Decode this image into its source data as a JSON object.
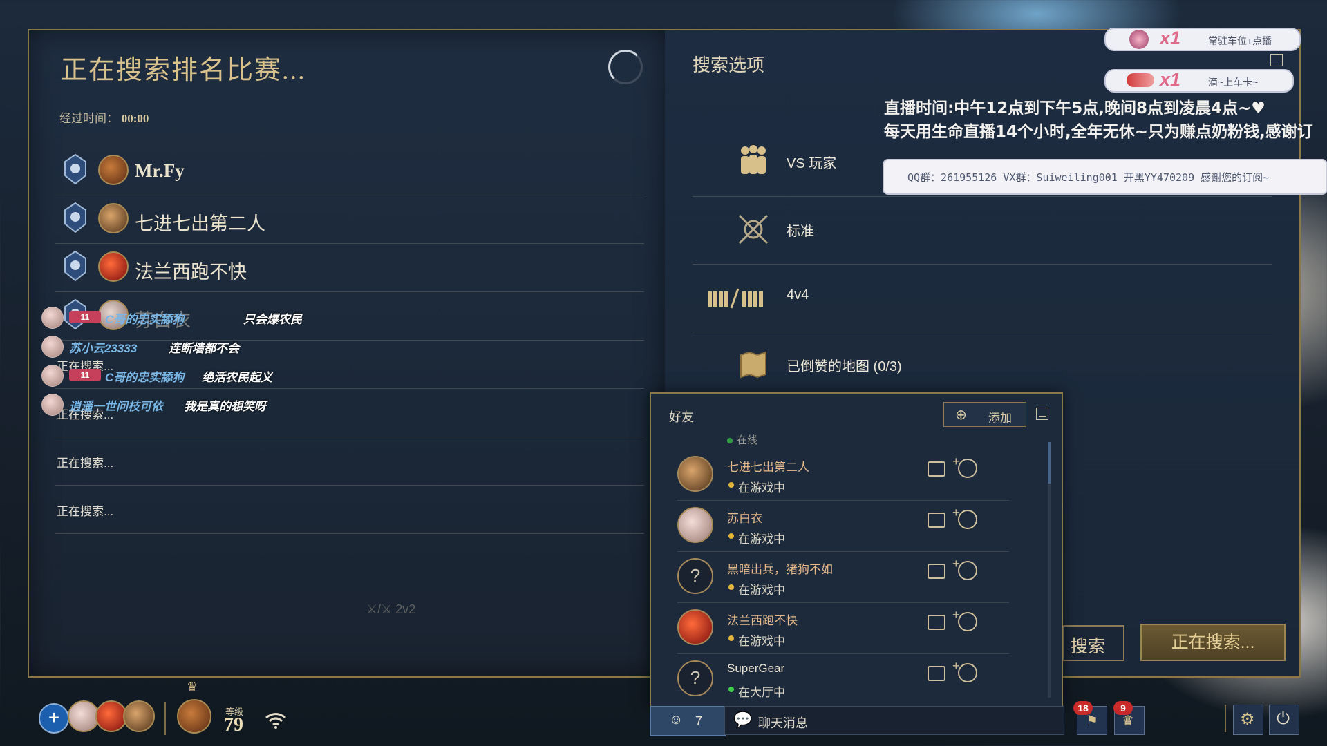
{
  "left_panel": {
    "title": "正在搜索排名比赛...",
    "elapsed_label": "经过时间：",
    "elapsed_value": "00:00",
    "players": [
      {
        "name": "Mr.Fy"
      },
      {
        "name": "七进七出第二人"
      },
      {
        "name": "法兰西跑不快"
      },
      {
        "name": "苏白衣"
      }
    ],
    "searching_slots": [
      "正在搜索...",
      "正在搜索...",
      "正在搜索...",
      "正在搜索..."
    ],
    "footer_mode": "2v2"
  },
  "chat_overlay": [
    {
      "badge": "11",
      "user": "C哥的忠实舔狗",
      "message": "只会爆农民"
    },
    {
      "badge": "",
      "user": "苏小云23333",
      "message": "连断墙都不会"
    },
    {
      "badge": "11",
      "user": "C哥的忠实舔狗",
      "message": "绝活农民起义"
    },
    {
      "badge": "",
      "user": "逍遥一世问枝可依",
      "message": "我是真的想笑呀"
    }
  ],
  "right_panel": {
    "title": "搜索选项",
    "options": [
      {
        "icon": "players-icon",
        "label": "VS 玩家"
      },
      {
        "icon": "crossed-swords-icon",
        "label": "标准"
      },
      {
        "icon": "team-size-icon",
        "label": "4v4"
      },
      {
        "icon": "map-icon",
        "label": "已倒赞的地图 (0/3)"
      }
    ],
    "search_button": "搜索",
    "searching_button": "正在搜索..."
  },
  "stream_overlay": {
    "line1": "直播时间:中午12点到下午5点,晚间8点到凌晨4点~♥",
    "line2": "每天用生命直播14个小时,全年无休~只为赚点奶粉钱,感谢订",
    "qq_info": "QQ群：261955126 VX群：Suiweiling001 开黑YY470209 感谢您的订阅~",
    "gifts": [
      {
        "count": "x1",
        "text": "常驻车位+点播"
      },
      {
        "count": "x1",
        "text": "滴~上车卡~"
      }
    ]
  },
  "friends_panel": {
    "title": "好友",
    "add_label": "添加",
    "partial_status": "在线",
    "friends": [
      {
        "name": "七进七出第二人",
        "status": "在游戏中",
        "status_color": "#e2b43a"
      },
      {
        "name": "苏白衣",
        "status": "在游戏中",
        "status_color": "#e2b43a"
      },
      {
        "name": "黑暗出兵，猪狗不如",
        "status": "在游戏中",
        "status_color": "#e2b43a"
      },
      {
        "name": "法兰西跑不快",
        "status": "在游戏中",
        "status_color": "#e2b43a"
      },
      {
        "name": "SuperGear",
        "status": "在大厅中",
        "status_color": "#3fcf4a"
      }
    ]
  },
  "bottom_bar": {
    "level_label": "等级",
    "level_value": "79",
    "friends_count": "7",
    "chat_label": "聊天消息",
    "notif_count_1": "18",
    "notif_count_2": "9"
  },
  "colors": {
    "gold": "#d9c28c",
    "panel_bg": "#1b2838",
    "border": "#8b7748",
    "online_green": "#3fcf4a",
    "ingame_yellow": "#e2b43a"
  }
}
